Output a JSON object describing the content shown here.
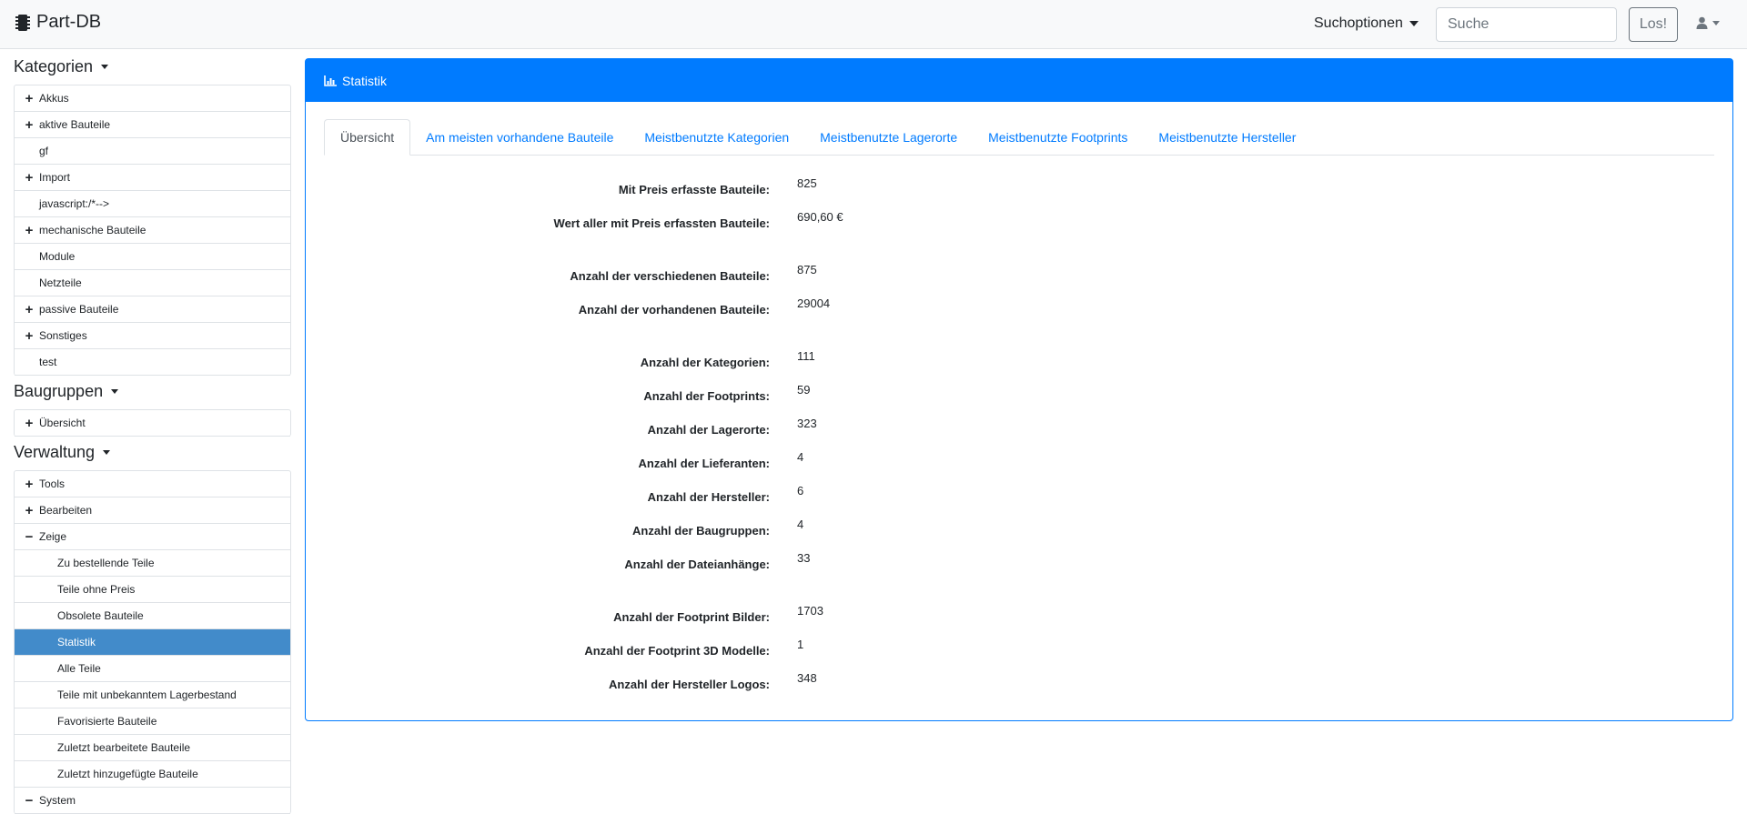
{
  "navbar": {
    "brand": "Part-DB",
    "search_options": "Suchoptionen",
    "search_placeholder": "Suche",
    "go_button": "Los!"
  },
  "sidebar": {
    "categories": {
      "title": "Kategorien",
      "items": [
        {
          "label": "Akkus",
          "expandable": true
        },
        {
          "label": "aktive Bauteile",
          "expandable": true
        },
        {
          "label": "gf",
          "expandable": false
        },
        {
          "label": "Import",
          "expandable": true
        },
        {
          "label": "javascript:/*-->",
          "expandable": false
        },
        {
          "label": "mechanische Bauteile",
          "expandable": true
        },
        {
          "label": "Module",
          "expandable": false
        },
        {
          "label": "Netzteile",
          "expandable": false
        },
        {
          "label": "passive Bauteile",
          "expandable": true
        },
        {
          "label": "Sonstiges",
          "expandable": true
        },
        {
          "label": "test",
          "expandable": false
        }
      ]
    },
    "assemblies": {
      "title": "Baugruppen",
      "items": [
        {
          "label": "Übersicht",
          "expandable": true
        }
      ]
    },
    "administration": {
      "title": "Verwaltung",
      "items": [
        {
          "label": "Tools",
          "toggle": "+",
          "child": false
        },
        {
          "label": "Bearbeiten",
          "toggle": "+",
          "child": false
        },
        {
          "label": "Zeige",
          "toggle": "−",
          "child": false
        },
        {
          "label": "Zu bestellende Teile",
          "toggle": "",
          "child": true
        },
        {
          "label": "Teile ohne Preis",
          "toggle": "",
          "child": true
        },
        {
          "label": "Obsolete Bauteile",
          "toggle": "",
          "child": true
        },
        {
          "label": "Statistik",
          "toggle": "",
          "child": true,
          "active": true
        },
        {
          "label": "Alle Teile",
          "toggle": "",
          "child": true
        },
        {
          "label": "Teile mit unbekanntem Lagerbestand",
          "toggle": "",
          "child": true
        },
        {
          "label": "Favorisierte Bauteile",
          "toggle": "",
          "child": true
        },
        {
          "label": "Zuletzt bearbeitete Bauteile",
          "toggle": "",
          "child": true
        },
        {
          "label": "Zuletzt hinzugefügte Bauteile",
          "toggle": "",
          "child": true
        },
        {
          "label": "System",
          "toggle": "−",
          "child": false
        }
      ]
    }
  },
  "main": {
    "card_title": "Statistik",
    "tabs": [
      {
        "label": "Übersicht",
        "active": true
      },
      {
        "label": "Am meisten vorhandene Bauteile"
      },
      {
        "label": "Meistbenutzte Kategorien"
      },
      {
        "label": "Meistbenutzte Lagerorte"
      },
      {
        "label": "Meistbenutzte Footprints"
      },
      {
        "label": "Meistbenutzte Hersteller"
      }
    ],
    "stats": [
      {
        "label": "Mit Preis erfasste Bauteile:",
        "value": "825"
      },
      {
        "label": "Wert aller mit Preis erfassten Bauteile:",
        "value": "690,60 €"
      },
      {
        "label": "Anzahl der verschiedenen Bauteile:",
        "value": "875"
      },
      {
        "label": "Anzahl der vorhandenen Bauteile:",
        "value": "29004"
      },
      {
        "label": "Anzahl der Kategorien:",
        "value": "111"
      },
      {
        "label": "Anzahl der Footprints:",
        "value": "59"
      },
      {
        "label": "Anzahl der Lagerorte:",
        "value": "323"
      },
      {
        "label": "Anzahl der Lieferanten:",
        "value": "4"
      },
      {
        "label": "Anzahl der Hersteller:",
        "value": "6"
      },
      {
        "label": "Anzahl der Baugruppen:",
        "value": "4"
      },
      {
        "label": "Anzahl der Dateianhänge:",
        "value": "33"
      },
      {
        "label": "Anzahl der Footprint Bilder:",
        "value": "1703"
      },
      {
        "label": "Anzahl der Footprint 3D Modelle:",
        "value": "1"
      },
      {
        "label": "Anzahl der Hersteller Logos:",
        "value": "348"
      }
    ]
  }
}
